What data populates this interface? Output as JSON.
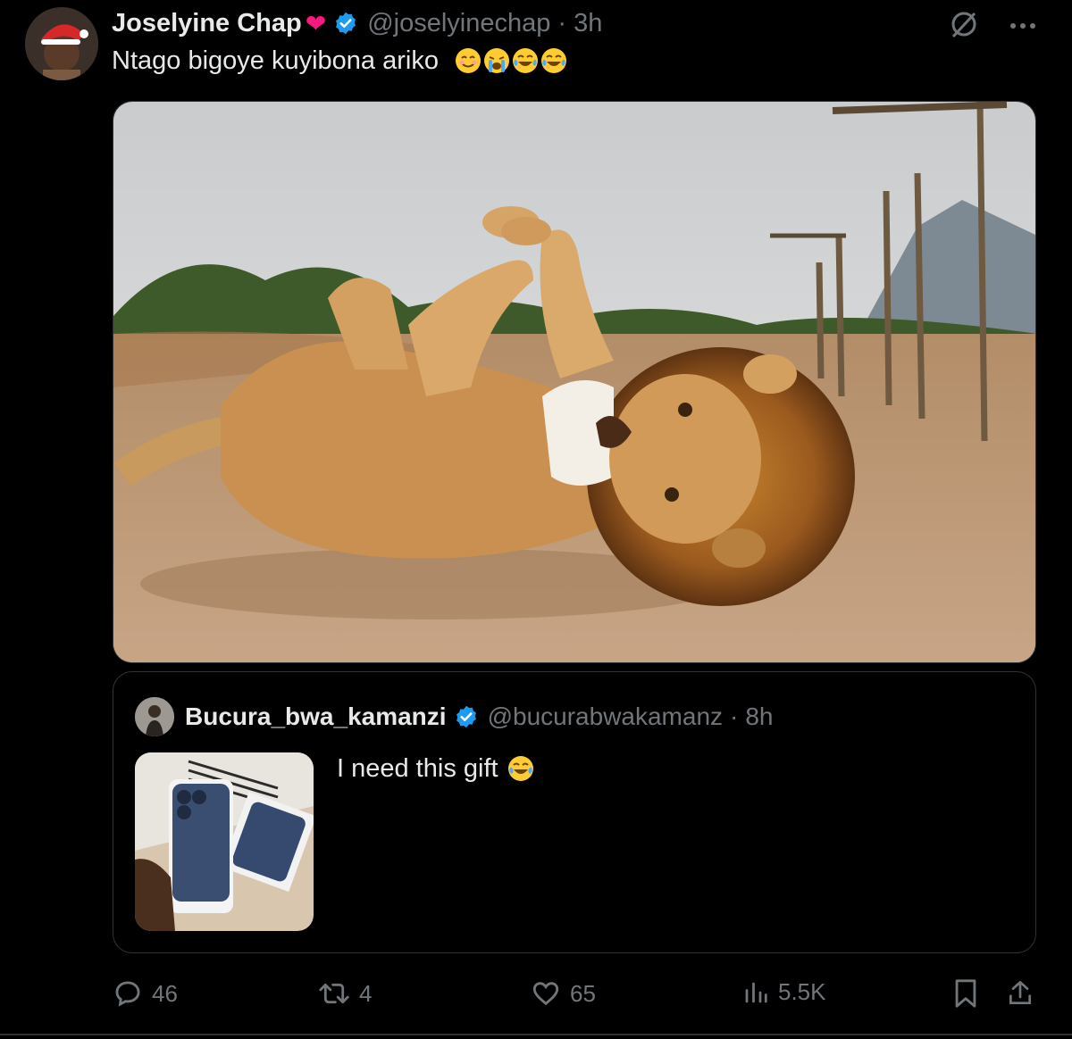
{
  "author": {
    "name": "Joselyine Chap",
    "handle": "@joselyinechap",
    "separator": "·",
    "time": "3h"
  },
  "tweet": {
    "text": "Ntago bigoye kuyibona ariko",
    "emojis": [
      "smiling-face-icon",
      "crying-face-icon",
      "tears-of-joy-icon",
      "tears-of-joy-icon"
    ]
  },
  "media": {
    "alt_icon": "lion-photo"
  },
  "quote": {
    "name": "Bucura_bwa_kamanzi",
    "handle": "@bucurabwakamanz",
    "separator": "·",
    "time": "8h",
    "text": "I need this gift",
    "emoji": "tears-of-joy-icon"
  },
  "actions": {
    "replies": "46",
    "reposts": "4",
    "likes": "65",
    "views": "5.5K"
  },
  "colors": {
    "background": "#000000",
    "text": "#e7e9ea",
    "muted": "#71767b",
    "verified": "#1d9bf0",
    "heart": "#f91880",
    "border": "#2f3336"
  }
}
